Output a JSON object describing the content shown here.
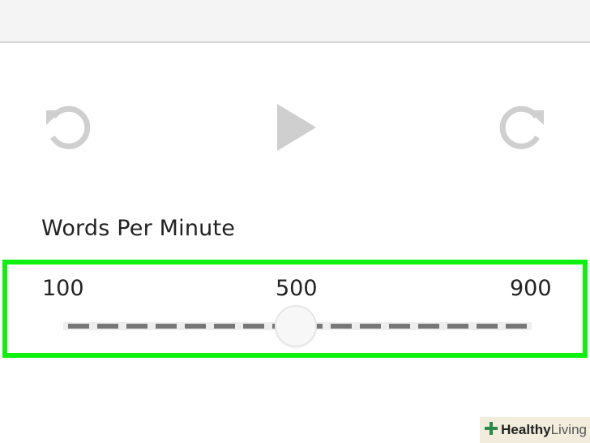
{
  "controls": {
    "rewind_icon": "rewind-icon",
    "play_icon": "play-icon",
    "forward_icon": "forward-icon",
    "icon_color": "#cfcfcf"
  },
  "speed": {
    "label": "Words Per Minute",
    "min_label": "100",
    "mid_label": "500",
    "max_label": "900",
    "value": 500,
    "highlight_color": "#0ef10e"
  },
  "watermark": {
    "text_bold": "Healthy",
    "text_light": "Living"
  }
}
